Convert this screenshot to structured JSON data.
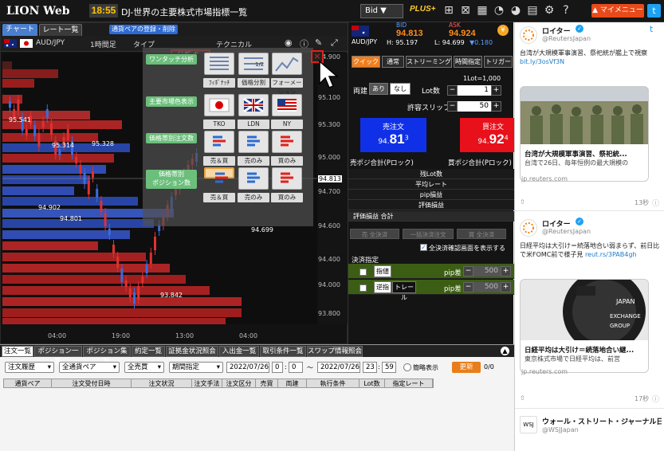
{
  "topbar": {
    "logo": "LION Web",
    "time": "18:55",
    "news": "DJ-世界の主要株式市場指標一覧",
    "bid_select": "Bid ▼",
    "plus_label": "PLUS+",
    "my_menu": "▲ マイメニュー",
    "twitter": "t"
  },
  "chart_tabs": {
    "chart": "チャート",
    "rate_list": "レート一覧",
    "register": "通貨ペアの登録・削除"
  },
  "chart_toolbar": {
    "pair": "AUD/JPY",
    "interval": "1時間足",
    "type": "タイプ",
    "analysis": "分析",
    "technical": "テクニカル"
  },
  "y_ticks": [
    "94.900",
    "95.100",
    "95.300",
    "95.000",
    "94.813",
    "94.700",
    "94.600",
    "94.400",
    "94.000",
    "93.800"
  ],
  "x_ticks": [
    "04:00",
    "19:00",
    "13:00",
    "04:00"
  ],
  "chart_annotations": {
    "high1": "95.541",
    "high2": "95.314",
    "high3": "95.328",
    "low1": "94.902",
    "low2": "94.801",
    "mid": "94.699",
    "low": "93.842",
    "current": "94.813"
  },
  "panel": {
    "one_touch": "ワンタッチ分析",
    "fibonacci": "ﾌｨﾎﾞﾅｯﾁ",
    "price_split": "価格分割",
    "formation": "フォーメーション",
    "market_display": "主要市場色表示",
    "tko": "TKO",
    "ldn": "LDN",
    "ny": "NY",
    "order_count": "価格帯別注文数",
    "pos_count1": "価格帯別",
    "pos_count2": "ポジション数",
    "sell_buy": "売＆買",
    "sell_only": "売のみ",
    "buy_only": "買のみ"
  },
  "order": {
    "pair": "AUD/JPY",
    "bid_label": "BID",
    "ask_label": "ASK",
    "bid": "94.813",
    "ask": "94.924",
    "high": "H: 95.197",
    "low": "L: 94.699",
    "change": "▼0.180",
    "tabs": [
      "クイック",
      "通常",
      "ストリーミング",
      "時間指定",
      "トリガー"
    ],
    "both": "両建",
    "yes": "あり",
    "no": "なし",
    "lot_label": "Lot数",
    "lot_unit": "1Lot=1,000",
    "lot": "1",
    "slip_label": "許容スリップ",
    "slip": "50",
    "sell_label": "売注文",
    "buy_label": "買注文",
    "sell_small": "94.",
    "sell_big": "81",
    "sell_sup": "3",
    "buy_small": "94.",
    "buy_big": "92",
    "buy_sup": "4",
    "sell_total": "売ポジ合計(Pロック)",
    "buy_total": "買ポジ合計(Pロック)",
    "rows": [
      "残Lot数",
      "平均レート",
      "pip損益",
      "評価損益"
    ],
    "pl_total": "評価損益 合計",
    "settle_btns": [
      "売 全決済",
      "一括決済注文",
      "買 全決済"
    ],
    "confirm": "全決済確認画面を表示する",
    "settle_spec": "決済指定",
    "limit": "指値",
    "stop": "逆指",
    "trail": "トレール",
    "pip_diff": "pip差",
    "pip_val": "500"
  },
  "bottom": {
    "tabs": [
      "注文一覧",
      "ポジション一覧",
      "ポジション集計",
      "約定一覧",
      "証拠金状況照会",
      "入出金一覧",
      "取引条件一覧",
      "スワップ情報照会"
    ],
    "filters": [
      "注文履歴",
      "全通貨ペア",
      "全売買",
      "期間指定"
    ],
    "date_from": "2022/07/26",
    "h_from": "0",
    "m_from": "0",
    "date_to": "2022/07/26",
    "h_to": "23",
    "m_to": "59",
    "simple": "簡略表示",
    "update": "更新",
    "count": "0/0",
    "columns": [
      "通貨ペア",
      "注文受付日時",
      "注文状況",
      "注文手法",
      "注文区分",
      "売買",
      "両建",
      "執行条件",
      "Lot数",
      "指定レート"
    ]
  },
  "twitter": {
    "name": "ロイター",
    "handle": "@ReutersJapan",
    "t1": "台湾が大規模軍事演習、祭祀統が艦上で視察",
    "t1_link": "bit.ly/3osVf3N",
    "c1_title": "台湾が大規模軍事演習、祭祀統...",
    "c1_desc": "台湾で26日、毎年恒例の最大規模の",
    "c1_domain": "jp.reuters.com",
    "time1": "13秒",
    "t2": "日経平均は大引け＝続落地合い弱まらず、前日比で米FOMC前で様子見",
    "t2_link": "reut.rs/3PAB4gh",
    "c2_title": "日経平均は大引け＝続落地合い継...",
    "c2_desc": "東京株式市場で日経平均は、前営",
    "c2_domain": "jp.reuters.com",
    "time2": "17秒",
    "wsj_name": "ウォール・ストリート・ジャーナル日",
    "wsj_handle": "@WSJJapan"
  }
}
